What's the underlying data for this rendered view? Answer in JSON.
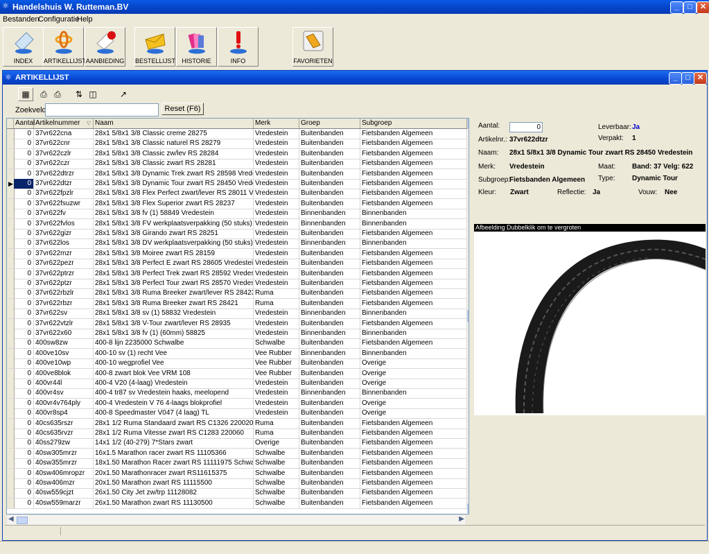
{
  "app": {
    "title": "Handelshuis W. Rutteman.BV",
    "menu": [
      "Bestanden",
      "Configuratie",
      "Help"
    ],
    "toolbar": [
      "INDEX",
      "ARTIKELLIJST",
      "AANBIEDING",
      "BESTELLIJST",
      "HISTORIE",
      "INFO",
      "FAVORIETEN"
    ]
  },
  "child": {
    "title": "ARTIKELLIJST",
    "search_label": "Zoekveld",
    "search_value": "",
    "reset_label": "Reset (F6)"
  },
  "grid": {
    "columns": [
      "Aantal",
      "Artikelnummer",
      "Naam",
      "Merk",
      "Groep",
      "Subgroep"
    ],
    "rows": [
      [
        "0",
        "37vr622cna",
        "28x1 5/8x1 3/8 Classic creme 28275",
        "Vredestein",
        "Buitenbanden",
        "Fietsbanden Algemeen"
      ],
      [
        "0",
        "37vr622cnr",
        "28x1 5/8x1 3/8 Classic naturel RS 28279",
        "Vredestein",
        "Buitenbanden",
        "Fietsbanden Algemeen"
      ],
      [
        "0",
        "37vr622czlr",
        "28x1 5/8x1 3/8 Classic zw/lev RS 28284",
        "Vredestein",
        "Buitenbanden",
        "Fietsbanden Algemeen"
      ],
      [
        "0",
        "37vr622czr",
        "28x1 5/8x1 3/8 Classic zwart RS 28281",
        "Vredestein",
        "Buitenbanden",
        "Fietsbanden Algemeen"
      ],
      [
        "0",
        "37vr622dtrzr",
        "28x1 5/8x1 3/8 Dynamic Trek zwart RS 28598 Vredestein",
        "Vredestein",
        "Buitenbanden",
        "Fietsbanden Algemeen"
      ],
      [
        "0",
        "37vr622dtzr",
        "28x1 5/8x1 3/8 Dynamic Tour zwart RS 28450 Vredestein",
        "Vredestein",
        "Buitenbanden",
        "Fietsbanden Algemeen"
      ],
      [
        "0",
        "37vr622fpzlr",
        "28x1 5/8x1 3/8 Flex Perfect zwart/lever RS 28011 Vredeste",
        "Vredestein",
        "Buitenbanden",
        "Fietsbanden Algemeen"
      ],
      [
        "0",
        "37vr622fsuzwr",
        "28x1 5/8x1 3/8 Flex Superior zwart RS 28237",
        "Vredestein",
        "Buitenbanden",
        "Fietsbanden Algemeen"
      ],
      [
        "0",
        "37vr622fv",
        "28x1 5/8x1 3/8 fv (1) 58849 Vredestein",
        "Vredestein",
        "Binnenbanden",
        "Binnenbanden"
      ],
      [
        "0",
        "37vr622fvlos",
        "28x1 5/8x1 3/8 FV werkplaatsverpakking (50 stuks) 58849 V",
        "Vredestein",
        "Binnenbanden",
        "Binnenbanden"
      ],
      [
        "0",
        "37vr622gizr",
        "28x1 5/8x1 3/8 Girando zwart RS 28251",
        "Vredestein",
        "Buitenbanden",
        "Fietsbanden Algemeen"
      ],
      [
        "0",
        "37vr622los",
        "28x1 5/8x1 3/8 DV werkplaatsverpakking (50 stuks) 58915 V",
        "Vredestein",
        "Binnenbanden",
        "Binnenbanden"
      ],
      [
        "0",
        "37vr622mzr",
        "28x1 5/8x1 3/8 Moiree zwart RS 28159",
        "Vredestein",
        "Buitenbanden",
        "Fietsbanden Algemeen"
      ],
      [
        "0",
        "37vr622pezr",
        "28x1 5/8x1 3/8 Perfect E zwart RS 28605 Vredestein",
        "Vredestein",
        "Buitenbanden",
        "Fietsbanden Algemeen"
      ],
      [
        "0",
        "37vr622ptrzr",
        "28x1 5/8x1 3/8 Perfect Trek zwart RS 28592 Vredestein",
        "Vredestein",
        "Buitenbanden",
        "Fietsbanden Algemeen"
      ],
      [
        "0",
        "37vr622ptzr",
        "28x1 5/8x1 3/8 Perfect Tour zwart RS 28570 Vredestein",
        "Vredestein",
        "Buitenbanden",
        "Fietsbanden Algemeen"
      ],
      [
        "0",
        "37vr622rbzlr",
        "28x1 5/8x1 3/8 Ruma Breeker zwart/lever RS 28423",
        "Ruma",
        "Buitenbanden",
        "Fietsbanden Algemeen"
      ],
      [
        "0",
        "37vr622rbzr",
        "28x1 5/8x1 3/8 Ruma Breeker zwart RS 28421",
        "Ruma",
        "Buitenbanden",
        "Fietsbanden Algemeen"
      ],
      [
        "0",
        "37vr622sv",
        "28x1 5/8x1 3/8 sv (1) 58832 Vredestein",
        "Vredestein",
        "Binnenbanden",
        "Binnenbanden"
      ],
      [
        "0",
        "37vr622vtzlr",
        "28x1 5/8x1 3/8 V-Tour zwart/lever RS 28935",
        "Vredestein",
        "Buitenbanden",
        "Fietsbanden Algemeen"
      ],
      [
        "0",
        "37vr622x60",
        "28x1 5/8x1 3/8 fv (1) (60mm) 58825",
        "Vredestein",
        "Binnenbanden",
        "Binnenbanden"
      ],
      [
        "0",
        "400sw8zw",
        "400-8 lijn 2235000 Schwalbe",
        "Schwalbe",
        "Buitenbanden",
        "Fietsbanden Algemeen"
      ],
      [
        "0",
        "400ve10sv",
        "400-10 sv (1) recht Vee",
        "Vee Rubber",
        "Binnenbanden",
        "Binnenbanden"
      ],
      [
        "0",
        "400ve10wp",
        "400-10 wegprofiel Vee",
        "Vee Rubber",
        "Buitenbanden",
        "Overige"
      ],
      [
        "0",
        "400ve8blok",
        "400-8 zwart blok Vee VRM 108",
        "Vee Rubber",
        "Buitenbanden",
        "Overige"
      ],
      [
        "0",
        "400vr44l",
        "400-4 V20 (4-laag) Vredestein",
        "Vredestein",
        "Buitenbanden",
        "Overige"
      ],
      [
        "0",
        "400vr4sv",
        "400-4 tr87 sv Vredestein haaks, meelopend",
        "Vredestein",
        "Binnenbanden",
        "Binnenbanden"
      ],
      [
        "0",
        "400vr4v764ply",
        "400-4 Vredestein V 76 4-laags blokprofiel",
        "Vredestein",
        "Buitenbanden",
        "Overige"
      ],
      [
        "0",
        "400vr8sp4",
        "400-8 Speedmaster V047 (4 laag) TL",
        "Vredestein",
        "Buitenbanden",
        "Overige"
      ],
      [
        "0",
        "40cs635rszr",
        "28x1 1/2 Ruma Standaard zwart RS C1326 220020",
        "Ruma",
        "Buitenbanden",
        "Fietsbanden Algemeen"
      ],
      [
        "0",
        "40cs635rvzr",
        "28x1 1/2 Ruma Vitesse zwart RS C1283 220060",
        "Ruma",
        "Buitenbanden",
        "Fietsbanden Algemeen"
      ],
      [
        "0",
        "40ss279zw",
        "14x1 1/2 (40-279) 7*Stars zwart",
        "Overige",
        "Buitenbanden",
        "Fietsbanden Algemeen"
      ],
      [
        "0",
        "40sw305mrzr",
        "16x1.5 Marathon racer zwart RS 11105366",
        "Schwalbe",
        "Buitenbanden",
        "Fietsbanden Algemeen"
      ],
      [
        "0",
        "40sw355mrzr",
        "18x1.50 Marathon Racer zwart RS 11111975 Schwalbe",
        "Schwalbe",
        "Buitenbanden",
        "Fietsbanden Algemeen"
      ],
      [
        "0",
        "40sw406mropzr",
        "20x1.50 Marathonracer zwart RS11615375",
        "Schwalbe",
        "Buitenbanden",
        "Fietsbanden Algemeen"
      ],
      [
        "0",
        "40sw406mzr",
        "20x1.50 Marathon zwart RS 11115500",
        "Schwalbe",
        "Buitenbanden",
        "Fietsbanden Algemeen"
      ],
      [
        "0",
        "40sw559cjzt",
        "26x1.50 City Jet zw/trp 11128082",
        "Schwalbe",
        "Buitenbanden",
        "Fietsbanden Algemeen"
      ],
      [
        "0",
        "40sw559marzr",
        "26x1.50 Marathon zwart RS 11130500",
        "Schwalbe",
        "Buitenbanden",
        "Fietsbanden Algemeen"
      ]
    ],
    "selected_row": 5
  },
  "detail": {
    "aantal_label": "Aantal:",
    "aantal_value": "0",
    "leverbaar_label": "Leverbaar:",
    "leverbaar_value": "Ja",
    "artikelnr_label": "Artikelnr.:",
    "artikelnr_value": "37vr622dtzr",
    "verpakt_label": "Verpakt:",
    "verpakt_value": "1",
    "naam_label": "Naam:",
    "naam_value": "28x1 5/8x1 3/8 Dynamic Tour zwart RS 28450 Vredestein",
    "merk_label": "Merk:",
    "merk_value": "Vredestein",
    "maat_label": "Maat:",
    "maat_value": "Band: 37 Velg: 622",
    "subgroep_label": "Subgroep:",
    "subgroep_value": "Fietsbanden Algemeen",
    "type_label": "Type:",
    "type_value": "Dynamic Tour",
    "kleur_label": "Kleur:",
    "kleur_value": "Zwart",
    "reflectie_label": "Reflectie:",
    "reflectie_value": "Ja",
    "vouw_label": "Vouw:",
    "vouw_value": "Nee",
    "image_caption": "Afbeelding Dubbelklik om te vergroten"
  },
  "colors": {
    "title_blue": "#0a3cb4",
    "accent_link": "#0000cc"
  }
}
